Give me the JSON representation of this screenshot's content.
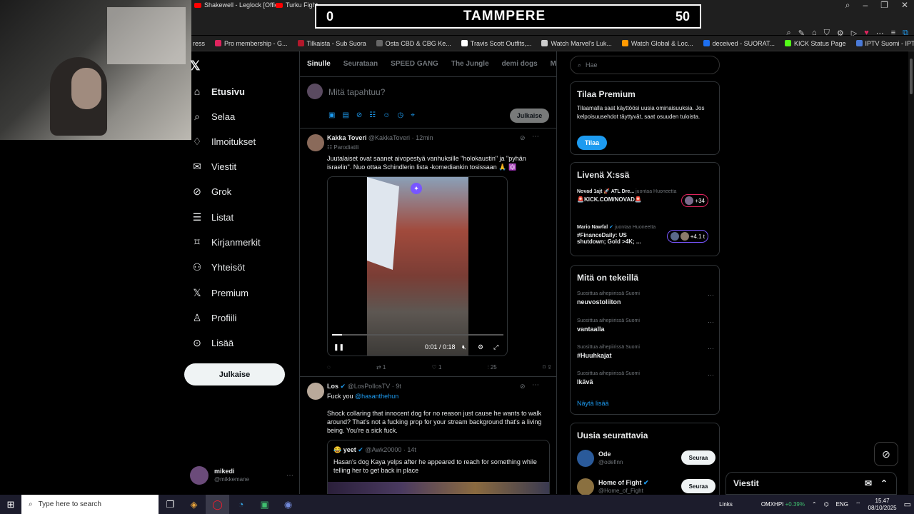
{
  "browser": {
    "tabs": [
      "Shakewell - Leglock [Offic",
      "Turku Fight"
    ],
    "bookmarks": [
      "ress",
      "Pro membership - G...",
      "Tilkaista - Sub Suora",
      "Osta CBD & CBG Ke...",
      "Travis Scott Outfits,...",
      "Watch Marvel's Luk...",
      "Watch Global & Loc...",
      "deceived - SUORAT...",
      "KICK Status Page",
      "IPTV Suomi - IPTV u..."
    ]
  },
  "scoreboard": {
    "left": "0",
    "team": "TAMMPERE",
    "right": "50"
  },
  "nav": {
    "items": [
      {
        "label": "Etusivu",
        "icon": "home-icon"
      },
      {
        "label": "Selaa",
        "icon": "search-icon"
      },
      {
        "label": "Ilmoitukset",
        "icon": "bell-icon"
      },
      {
        "label": "Viestit",
        "icon": "mail-icon"
      },
      {
        "label": "Grok",
        "icon": "grok-icon"
      },
      {
        "label": "Listat",
        "icon": "list-icon"
      },
      {
        "label": "Kirjanmerkit",
        "icon": "bookmark-icon"
      },
      {
        "label": "Yhteisöt",
        "icon": "people-icon"
      },
      {
        "label": "Premium",
        "icon": "x-icon"
      },
      {
        "label": "Profiili",
        "icon": "user-icon"
      },
      {
        "label": "Lisää",
        "icon": "more-icon"
      }
    ],
    "post_button": "Julkaise",
    "profile": {
      "name": "mikedi",
      "handle": "@mikkemane"
    }
  },
  "feed": {
    "tabs": [
      "Sinulle",
      "Seurataan",
      "SPEED GANG",
      "The Jungle",
      "demi dogs",
      "McDonal"
    ],
    "compose_placeholder": "Mitä tapahtuu?",
    "compose_button": "Julkaise",
    "tweet1": {
      "name": "Kakka Toveri",
      "handle": "@KakkaToveri",
      "time": "· 12min",
      "label": "Parodiatili",
      "text": "Juutalaiset ovat saanet aivopestyä vanhuksille \"holokaustin\" ja \"pyhän israelin\". Nuo ottaa Schindlerin lista -komediankin tosissaan 🙏 ✡️",
      "video_time": "0:01 / 0:18",
      "replies": "",
      "reposts": "1",
      "likes": "1",
      "views": "25"
    },
    "tweet2": {
      "name": "Los",
      "handle": "@LosPollosTV",
      "time": "· 9t",
      "reply_prefix": "Fuck you ",
      "mention": "@hasanthehun",
      "text": "Shock collaring that innocent dog for no reason just cause he wants to walk around? That's not a fucking prop for your stream background that's a living being. You're a sick fuck.",
      "quote_name": "yeet",
      "quote_handle": "@Awk20000 · 14t",
      "quote_text": "Hasan's dog Kaya yelps after he appeared to reach for something while telling her to get back in place"
    }
  },
  "sidebar": {
    "search_placeholder": "Hae",
    "premium": {
      "title": "Tilaa Premium",
      "text": "Tilaamalla saat käyttöösi uusia ominaisuuksia. Jos kelpoisuusehdot täyttyvät, saat osuuden tuloista.",
      "button": "Tilaa"
    },
    "live": {
      "title": "Livenä X:ssä",
      "items": [
        {
          "host": "Novad 1ajt 🚀 ATL Dre...",
          "status": "juontaa Huoneetta",
          "text": "🚨KICK.COM/NOVAD🚨",
          "count": "+34"
        },
        {
          "host": "Mario Nawfal",
          "status": "juontaa Huoneetta",
          "text": "#FinanceDaily: US shutdown; Gold >4K; ...",
          "count": "+4.1 t"
        }
      ]
    },
    "trends": {
      "title": "Mitä on tekeillä",
      "items": [
        {
          "category": "Suosittua aihepiirissä Suomi",
          "topic": "neuvostoliiton"
        },
        {
          "category": "Suosittua aihepiirissä Suomi",
          "topic": "vantaalla"
        },
        {
          "category": "Suosittua aihepiirissä Suomi",
          "topic": "#Huuhkajat"
        },
        {
          "category": "Suosittua aihepiirissä Suomi",
          "topic": "Ikävä"
        }
      ],
      "show_more": "Näytä lisää"
    },
    "who_to_follow": {
      "title": "Uusia seurattavia",
      "items": [
        {
          "name": "Ode",
          "handle": "@odefinn",
          "button": "Seuraa"
        },
        {
          "name": "Home of Fight",
          "handle": "@Home_of_Fight",
          "button": "Seuraa"
        }
      ]
    }
  },
  "messages_drawer": {
    "title": "Viestit"
  },
  "taskbar": {
    "search_placeholder": "Type here to search",
    "links_label": "Links",
    "ticker": "OMXHPI",
    "ticker_change": "+0.39%",
    "language": "ENG",
    "time": "15.47",
    "date": "08/10/2025"
  }
}
